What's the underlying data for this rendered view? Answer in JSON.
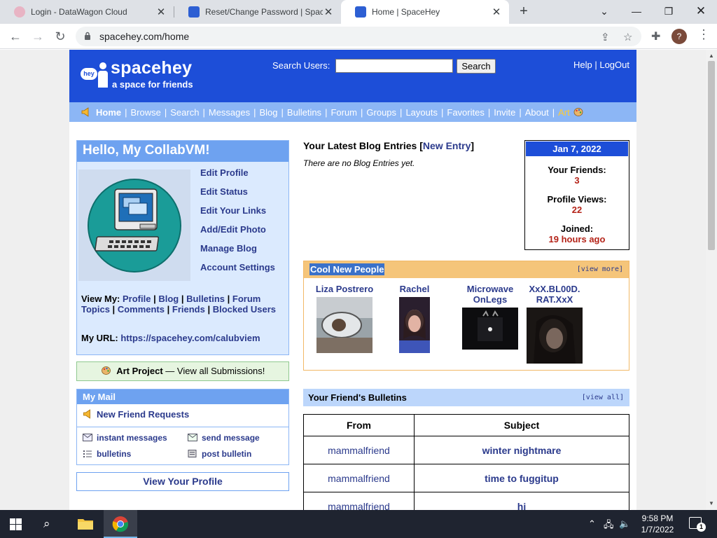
{
  "browser": {
    "tabs": [
      {
        "title": "Login - DataWagon Cloud",
        "active": false
      },
      {
        "title": "Reset/Change Password | SpaceHey",
        "active": false
      },
      {
        "title": "Home | SpaceHey",
        "active": true
      }
    ],
    "url": "spacehey.com/home",
    "profile_initial": "?"
  },
  "site": {
    "logo_badge": "hey",
    "logo_name": "spacehey",
    "logo_tagline": "a space for friends",
    "search_label": "Search Users:",
    "search_button": "Search",
    "header_links": [
      "Help",
      "LogOut"
    ],
    "nav": [
      "Home",
      "Browse",
      "Search",
      "Messages",
      "Blog",
      "Bulletins",
      "Forum",
      "Groups",
      "Layouts",
      "Favorites",
      "Invite",
      "About",
      "Art"
    ]
  },
  "profile_box": {
    "greeting": "Hello, My CollabVM!",
    "links": [
      "Edit Profile",
      "Edit Status",
      "Edit Your Links",
      "Add/Edit Photo",
      "Manage Blog",
      "Account Settings"
    ],
    "view_my_label": "View My:",
    "view_my_links": [
      "Profile",
      "Blog",
      "Bulletins",
      "Forum Topics",
      "Comments",
      "Friends",
      "Blocked Users"
    ],
    "url_label": "My URL:",
    "url": "https://spacehey.com/calubviem"
  },
  "art_project": {
    "title": "Art Project",
    "sep": "—",
    "link": "View all Submissions!"
  },
  "mail": {
    "title": "My Mail",
    "friend_requests": "New Friend Requests",
    "items": [
      "instant messages",
      "send message",
      "bulletins",
      "post bulletin"
    ]
  },
  "view_profile": "View Your Profile",
  "blog": {
    "title": "Your Latest Blog Entries",
    "new_entry": "New Entry",
    "empty": "There are no Blog Entries yet."
  },
  "stats": {
    "date": "Jan 7, 2022",
    "friends_label": "Your Friends:",
    "friends": "3",
    "views_label": "Profile Views:",
    "views": "22",
    "joined_label": "Joined:",
    "joined": "19 hours ago"
  },
  "cool_people": {
    "title": "Cool New People",
    "view_more": "[view more]",
    "people": [
      {
        "name": "Liza Postrero"
      },
      {
        "name": "Rachel"
      },
      {
        "name": "Microwave OnLegs"
      },
      {
        "name": "XxX.BL00D. RAT.XxX"
      }
    ]
  },
  "bulletins": {
    "title": "Your Friend's Bulletins",
    "view_all": "[view all]",
    "columns": [
      "From",
      "Subject"
    ],
    "rows": [
      {
        "from": "mammalfriend",
        "subject": "winter nightmare"
      },
      {
        "from": "mammalfriend",
        "subject": "time to fuggitup"
      },
      {
        "from": "mammalfriend",
        "subject": "hi"
      }
    ]
  },
  "taskbar": {
    "time": "9:58 PM",
    "date": "1/7/2022",
    "notifications": "1"
  },
  "colors": {
    "header_blue": "#1d4ed8",
    "nav_blue": "#8cb6f5",
    "link": "#2b3a8c",
    "stat_red": "#b42318"
  }
}
